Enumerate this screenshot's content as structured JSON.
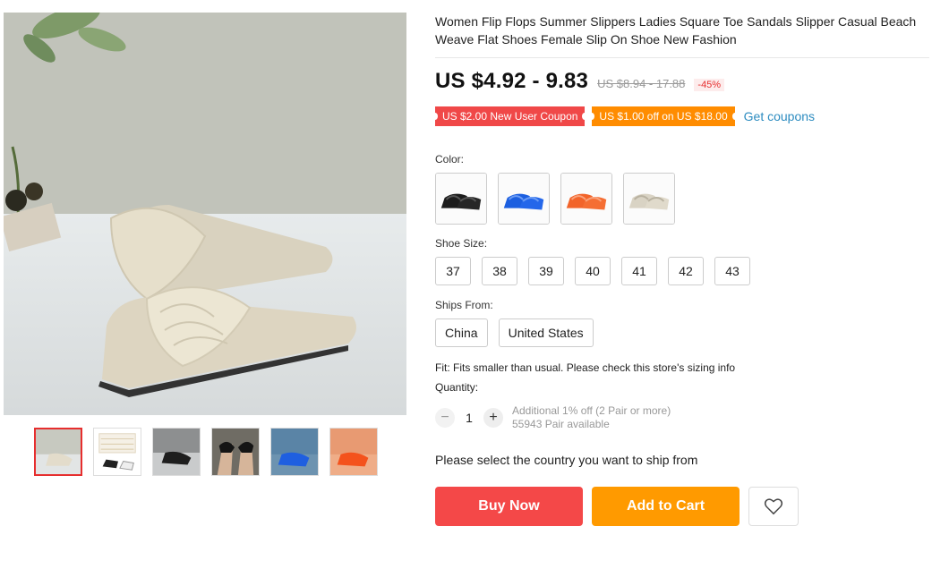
{
  "product": {
    "title": "Women Flip Flops Summer Slippers Ladies Square Toe Sandals Slipper Casual Beach Weave Flat Shoes Female Slip On Shoe New Fashion",
    "price": "US $4.92 - 9.83",
    "original_price": "US $8.94 - 17.88",
    "discount": "-45%"
  },
  "coupons": {
    "new_user": "US $2.00 New User Coupon",
    "store": "US $1.00 off on US $18.00",
    "get_link": "Get coupons"
  },
  "color": {
    "label": "Color:",
    "options": [
      {
        "name": "black",
        "hex": "#1c1c1c"
      },
      {
        "name": "blue",
        "hex": "#1c5fe0"
      },
      {
        "name": "orange",
        "hex": "#f2642a"
      },
      {
        "name": "beige",
        "hex": "#d9d3c4"
      }
    ]
  },
  "size": {
    "label": "Shoe Size:",
    "options": [
      "37",
      "38",
      "39",
      "40",
      "41",
      "42",
      "43"
    ]
  },
  "ships_from": {
    "label": "Ships From:",
    "options": [
      "China",
      "United States"
    ]
  },
  "fit": "Fit: Fits smaller than usual. Please check this store's sizing info",
  "quantity": {
    "label": "Quantity:",
    "value": "1",
    "additional": "Additional 1% off (2 Pair or more)",
    "available": "55943 Pair available"
  },
  "ship_message": "Please select the country you want to ship from",
  "actions": {
    "buy_now": "Buy Now",
    "add_to_cart": "Add to Cart"
  },
  "thumbnails": [
    "beige",
    "size-chart",
    "black",
    "black-worn",
    "blue",
    "orange"
  ],
  "colors": {
    "accent_red": "#f44848",
    "accent_orange": "#ff9a00",
    "link_blue": "#2d8cc0"
  }
}
